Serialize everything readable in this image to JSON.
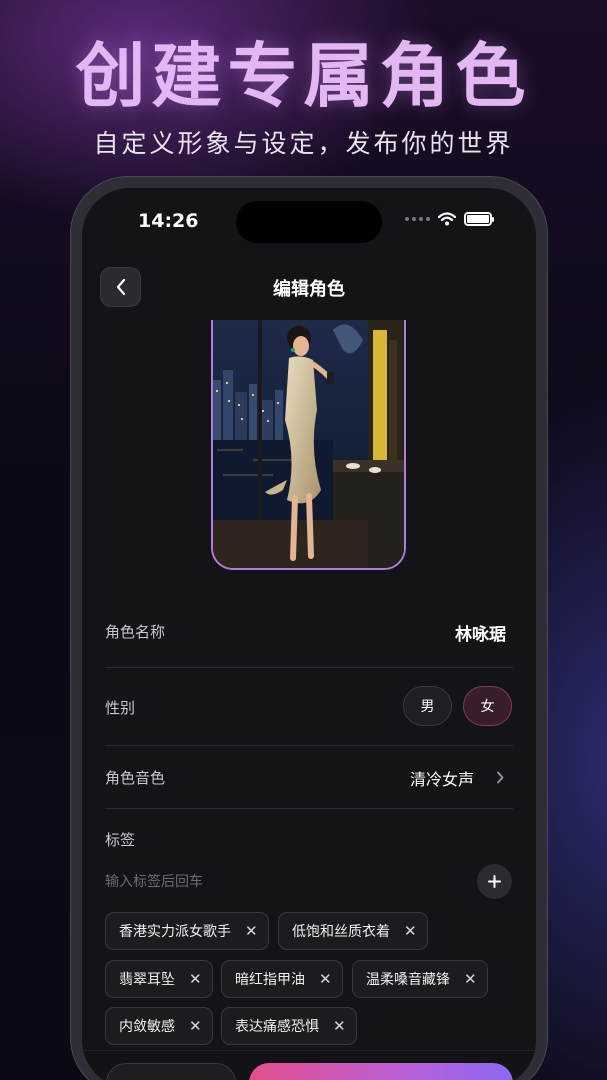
{
  "promo": {
    "title": "创建专属角色",
    "subtitle": "自定义形象与设定，发布你的世界"
  },
  "status_bar": {
    "time": "14:26"
  },
  "nav": {
    "title": "编辑角色",
    "back_icon": "chevron-left-icon"
  },
  "form": {
    "name_label": "角色名称",
    "name_value": "林咏琚",
    "gender_label": "性别",
    "gender_options": [
      "男",
      "女"
    ],
    "gender_selected": "女",
    "voice_label": "角色音色",
    "voice_value": "清冷女声",
    "tags_label": "标签",
    "tags_placeholder": "输入标签后回车",
    "tags": [
      "香港实力派女歌手",
      "低饱和丝质衣着",
      "翡翠耳坠",
      "暗红指甲油",
      "温柔嗓音藏锋",
      "内敛敏感",
      "表达痛感恐惧"
    ]
  },
  "colors": {
    "accent_pink": "#e3508a",
    "accent_purple": "#8a68f0",
    "promo_title": "#e3b6f4",
    "selected_gender_bg": "#3a1d2c"
  }
}
